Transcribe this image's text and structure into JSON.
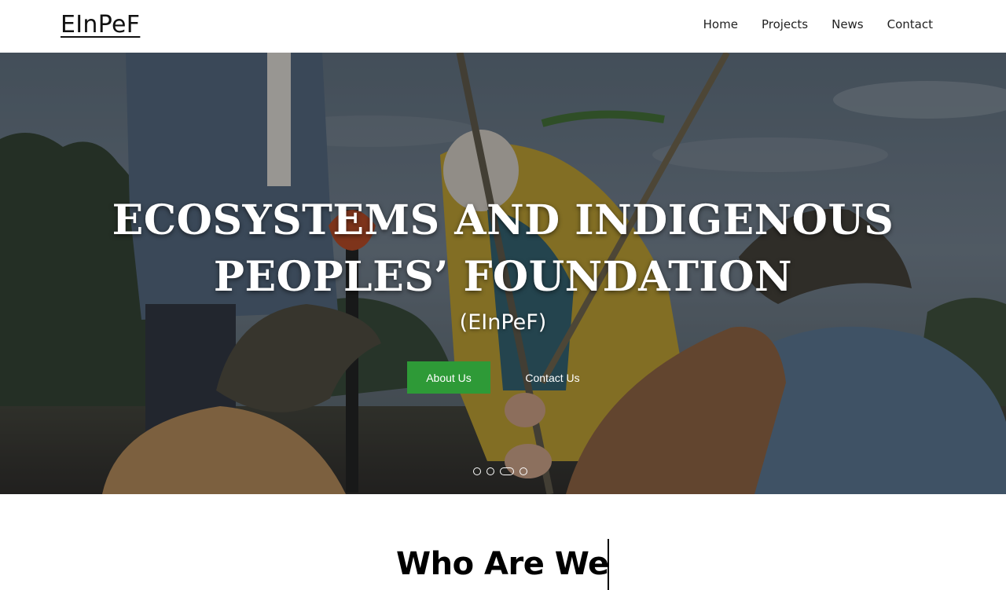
{
  "header": {
    "logo": "EInPeF",
    "nav": [
      "Home",
      "Projects",
      "News",
      "Contact"
    ]
  },
  "hero": {
    "title_line1": "ECOSYSTEMS AND INDIGENOUS",
    "title_line2": "PEOPLES’ FOUNDATION",
    "subtitle": "(EInPeF)",
    "primary_button": "About Us",
    "secondary_button": "Contact Us",
    "carousel": {
      "slides": 4,
      "active_index": 2
    }
  },
  "section": {
    "title": "Who Are We"
  },
  "colors": {
    "accent_green": "#2e9a37",
    "hero_overlay": "#3b4650"
  }
}
